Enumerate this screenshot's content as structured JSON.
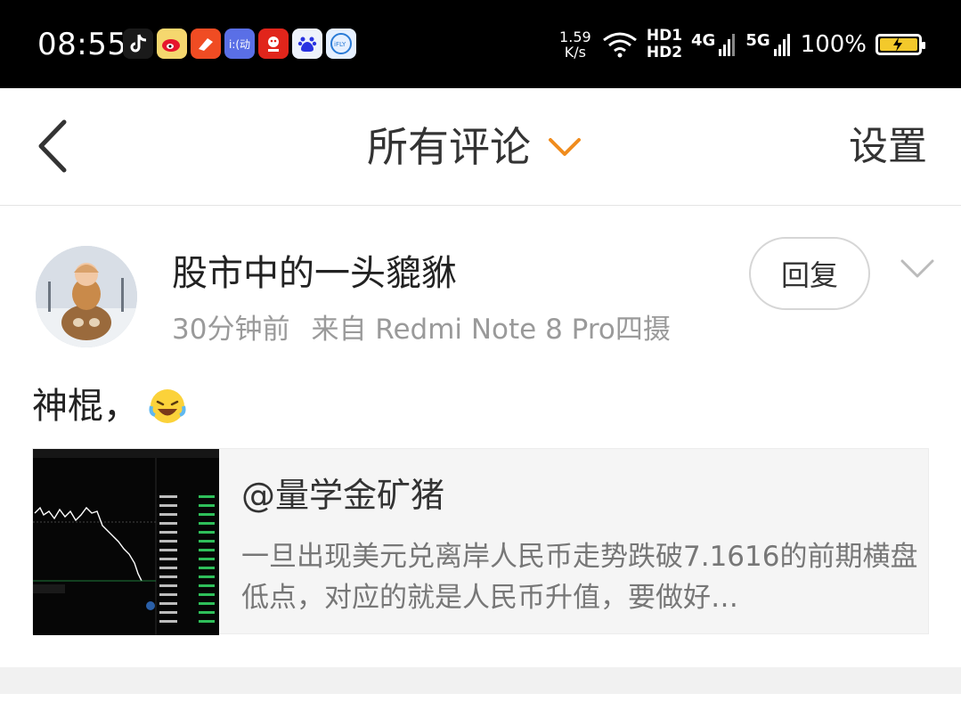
{
  "status_bar": {
    "time": "08:55",
    "net_speed_value": "1.59",
    "net_speed_unit": "K/s",
    "hd1": "HD1",
    "hd2": "HD2",
    "net1": "4G",
    "net2": "5G",
    "battery": "100%",
    "app_icons": [
      "douyin-icon",
      "weibo-icon",
      "news-app-icon",
      "sports-app-icon",
      "jd-icon",
      "baidu-icon",
      "ifly-icon"
    ]
  },
  "header": {
    "title": "所有评论",
    "settings": "设置"
  },
  "comment": {
    "username": "股市中的一头貔貅",
    "time": "30分钟前",
    "source": "来自 Redmi Note 8 Pro四摄",
    "reply_label": "回复",
    "text": "神棍，",
    "emoji": "laughing-crying-emoji"
  },
  "quoted": {
    "title": "@量学金矿猪",
    "text": "一旦出现美元兑离岸人民币走势跌破7.1616的前期横盘低点，对应的就是人民币升值，要做好…"
  },
  "colors": {
    "accent": "#f08c1e",
    "status_bar_bg": "#000000",
    "battery_fill": "#f3c92b"
  }
}
